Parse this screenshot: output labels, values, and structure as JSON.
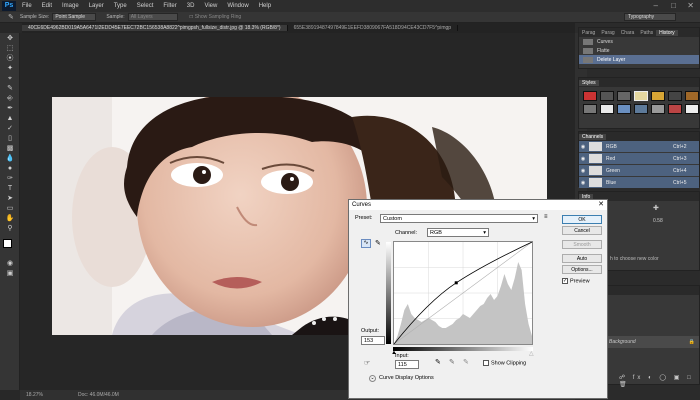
{
  "app": {
    "logo": "Ps"
  },
  "menu": [
    "File",
    "Edit",
    "Image",
    "Layer",
    "Type",
    "Select",
    "Filter",
    "3D",
    "View",
    "Window",
    "Help"
  ],
  "options": {
    "sample_size_label": "Sample Size:",
    "sample_size_value": "Point Sample",
    "sample_label": "Sample:",
    "sample_value": "All Layers",
    "show_ring_label": "Show Sampling Ring",
    "workspace": "Typography"
  },
  "tabs": [
    "40CE6DE4962BD019A5A6471I2EDD45E7EEC72BC156538A8822^pimgpsh_fullsize_distr.jpg @ 18.3% (RGB/8*)",
    "655E38919487497849E1EEFD3809067FA518D94CE43CD7F5^pimgp"
  ],
  "status": {
    "zoom": "18.27%",
    "doc": "Doc: 46.0M/46.0M"
  },
  "history": {
    "tabs": [
      "Parag",
      "Parag",
      "Chara",
      "Paths",
      "History"
    ],
    "items": [
      {
        "label": "Curves"
      },
      {
        "label": "Flatte"
      },
      {
        "label": "Delete Layer"
      }
    ]
  },
  "styles_label": "Styles",
  "channels": {
    "label": "Channels",
    "rows": [
      {
        "name": "RGB",
        "key": "Ctrl+2"
      },
      {
        "name": "Red",
        "key": "Ctrl+3"
      },
      {
        "name": "Green",
        "key": "Ctrl+4"
      },
      {
        "name": "Blue",
        "key": "Ctrl+5"
      }
    ]
  },
  "info": {
    "label": "Info",
    "values": [
      "0.58"
    ],
    "hint": "h to choose new color"
  },
  "layers": {
    "layer_name": "Background"
  },
  "curves": {
    "title": "Curves",
    "preset_label": "Preset:",
    "preset_value": "Custom",
    "channel_label": "Channel:",
    "channel_value": "RGB",
    "ok": "OK",
    "cancel": "Cancel",
    "smooth": "Smooth",
    "auto": "Auto",
    "options": "Options...",
    "preview": "Preview",
    "output_label": "Output:",
    "output_value": "153",
    "input_label": "Input:",
    "input_value": "115",
    "show_clipping": "Show Clipping",
    "display_options": "Curve Display Options",
    "curve_point": {
      "input": 115,
      "output": 153
    }
  },
  "colors": {
    "accent": "#5a6f92",
    "channel_row": "#4d627f",
    "ps_blue": "#31a8ff"
  }
}
